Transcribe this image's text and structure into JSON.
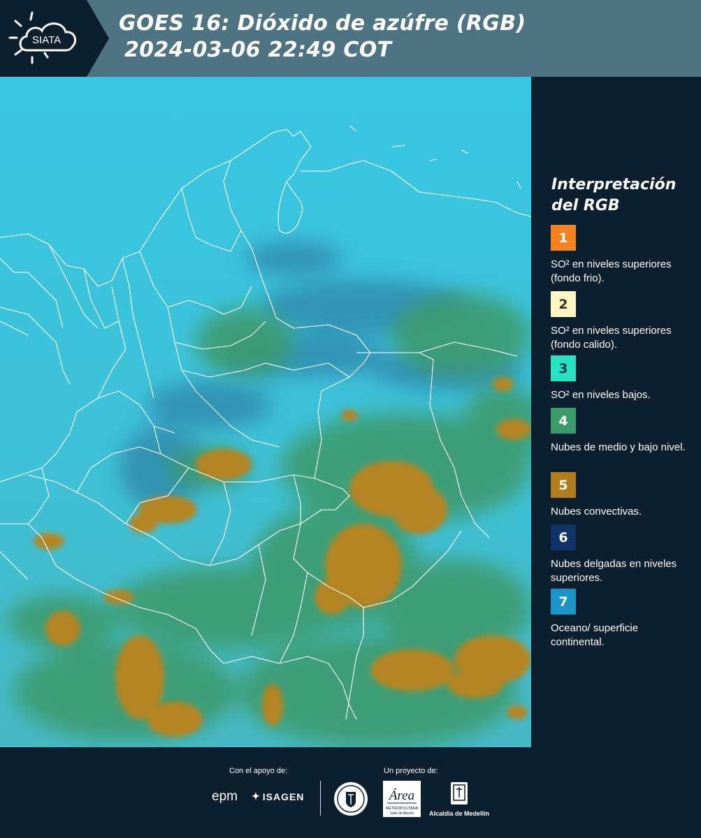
{
  "header": {
    "brand": "SIATA",
    "title": "GOES 16: Dióxido de azúfre (RGB)",
    "datetime": "2024-03-06 22:49 COT",
    "logo_icon": "siata-sun-cloud-icon",
    "background": "#4e7382"
  },
  "legend": {
    "title": "Interpretación del RGB",
    "items": [
      {
        "number": "1",
        "color": "#f5821f",
        "text_color": "#ffffff",
        "label": "SO² en niveles superiores (fondo frio)."
      },
      {
        "number": "2",
        "color": "#fdf7c4",
        "text_color": "#333333",
        "label": "SO² en niveles superiores (fondo calido)."
      },
      {
        "number": "3",
        "color": "#27e3c4",
        "text_color": "#1e3b4d",
        "label": "SO² en niveles bajos."
      },
      {
        "number": "4",
        "color": "#3a9a6a",
        "text_color": "#ffffff",
        "label": "Nubes de medio y bajo nivel."
      },
      {
        "number": "5",
        "color": "#b07d1e",
        "text_color": "#ffffff",
        "label": "Nubes convectivas."
      },
      {
        "number": "6",
        "color": "#10336a",
        "text_color": "#ffffff",
        "label": "Nubes delgadas en niveles superiores."
      },
      {
        "number": "7",
        "color": "#1995c8",
        "text_color": "#ffffff",
        "label": "Oceano/ superficie continental."
      }
    ]
  },
  "map": {
    "colors": {
      "ocean_surface": "#3cc4dd",
      "low_cloud": "#3d9a6a",
      "convective": "#b58424",
      "thin_high": "#2b6f99",
      "borders": "#ffffff"
    }
  },
  "footer": {
    "support_label": "Con el apoyo de:",
    "project_label": "Un proyecto de:",
    "sponsors": [
      "epm",
      "ISAGEN"
    ],
    "partners": {
      "amva_name": "Área",
      "amva_caption_1": "METROPOLITANA",
      "amva_caption_2": "Valle de Aburrá",
      "alcaldia": "Alcaldía de Medellín"
    }
  }
}
